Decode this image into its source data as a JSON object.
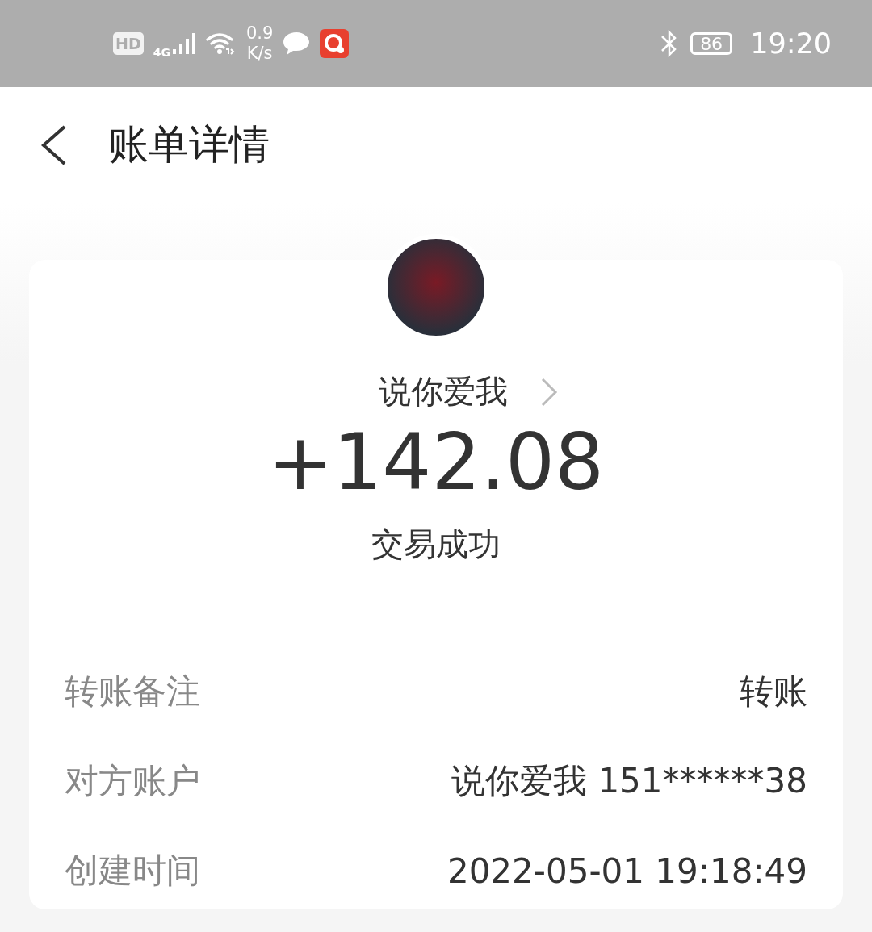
{
  "status_bar": {
    "hd": "HD",
    "network": "4G",
    "speed_value": "0.9",
    "speed_unit": "K/s",
    "battery": "86",
    "time": "19:20"
  },
  "header": {
    "title": "账单详情"
  },
  "bill": {
    "payee": "说你爱我",
    "amount": "+142.08",
    "status": "交易成功",
    "details": [
      {
        "label": "转账备注",
        "value": "转账"
      },
      {
        "label": "对方账户",
        "value": "说你爱我 151******38"
      },
      {
        "label": "创建时间",
        "value": "2022-05-01 19:18:49"
      }
    ]
  }
}
